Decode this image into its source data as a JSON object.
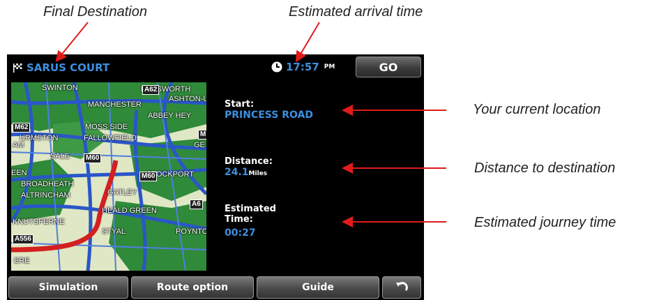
{
  "annotations": {
    "final_destination": "Final Destination",
    "estimated_arrival_time": "Estimated arrival time",
    "current_location": "Your current location",
    "distance_to_destination": "Distance to destination",
    "estimated_journey_time": "Estimated journey time"
  },
  "header": {
    "destination": "SARUS COURT",
    "flag_icon": "checkered-flag-icon",
    "clock_icon": "clock-icon",
    "eta_time": "17:57",
    "eta_ampm": "PM",
    "go_label": "GO"
  },
  "map": {
    "labels": [
      "SWINTON",
      "FAILSWORTH",
      "ASHTON-U",
      "MANCHESTER",
      "ABBEY HEY",
      "MOSS SIDE",
      "URMSTON",
      "FALLOWFIELD",
      "SALE",
      "STOCKPORT",
      "BROADHEATH",
      "ALTRINCHAM",
      "GATLEY",
      "HEALD GREEN",
      "STYAL",
      "POYNTO",
      "KNUTSFERNE",
      "AM",
      "EEN",
      "GE",
      "ERE"
    ],
    "roads": [
      "A62",
      "M62",
      "M",
      "M60",
      "M60",
      "A6",
      "A556"
    ]
  },
  "info": {
    "start_label": "Start:",
    "start_value": "PRINCESS ROAD",
    "distance_label": "Distance:",
    "distance_value": "24.1",
    "distance_unit": "Miles",
    "time_label_1": "Estimated",
    "time_label_2": "Time:",
    "time_value": "00:27"
  },
  "footer": {
    "simulation": "Simulation",
    "route_option": "Route option",
    "guide": "Guide",
    "back_icon": "back-arrow-icon"
  },
  "colors": {
    "accent": "#3d8fe0",
    "route": "#d32020",
    "annotation_arrow": "#e01b1b"
  }
}
